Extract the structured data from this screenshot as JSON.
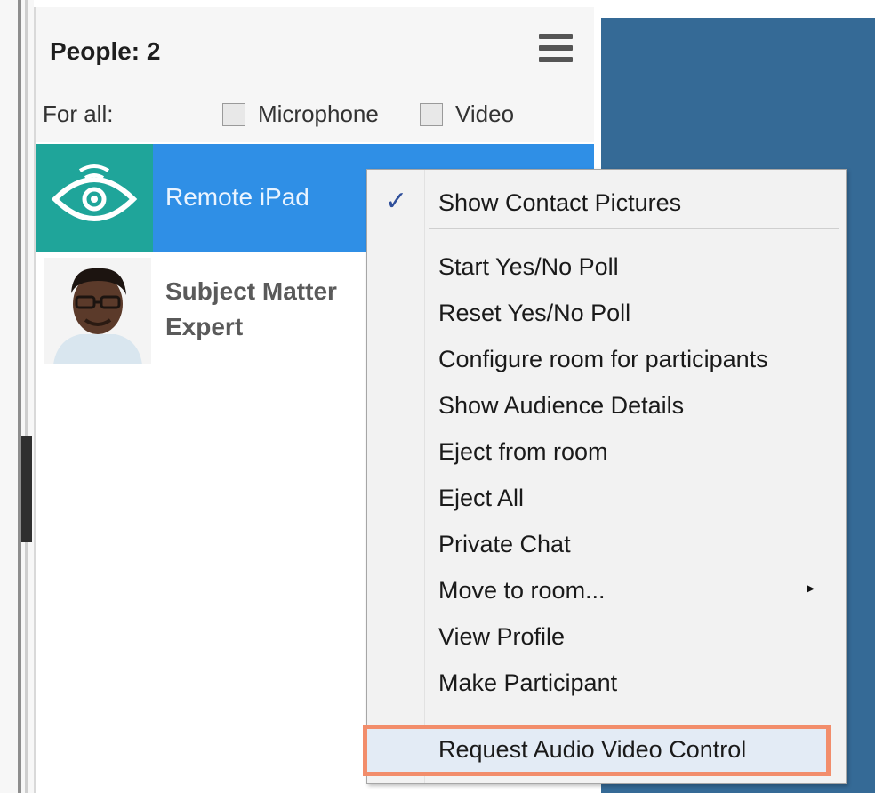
{
  "people_panel": {
    "header": "People: 2",
    "for_all_label": "For all:",
    "microphone_label": "Microphone",
    "video_label": "Video",
    "participants": [
      {
        "name": "Remote iPad"
      },
      {
        "name_line1": "Subject Matter",
        "name_line2": "Expert"
      }
    ]
  },
  "context_menu": {
    "items": [
      {
        "label": "Show Contact Pictures",
        "checked": true
      },
      {
        "label": "Start Yes/No Poll"
      },
      {
        "label": "Reset Yes/No Poll"
      },
      {
        "label": "Configure room for participants"
      },
      {
        "label": "Show Audience Details"
      },
      {
        "label": "Eject from room"
      },
      {
        "label": "Eject All"
      },
      {
        "label": "Private Chat"
      },
      {
        "label": "Move to room...",
        "submenu_arrow": "▸"
      },
      {
        "label": "View Profile"
      },
      {
        "label": "Make Participant"
      },
      {
        "label": "Request Audio Video Control",
        "highlighted": true
      }
    ],
    "check_glyph": "✓"
  },
  "colors": {
    "selected_row": "#2f8fe6",
    "eye_tile": "#1fa59a",
    "right_area": "#356a96",
    "highlight_border": "#f28d6b"
  },
  "icons": {
    "menu": "hamburger-icon",
    "eye": "eye-broadcast-icon",
    "check": "check-icon",
    "arrow": "submenu-arrow-icon"
  }
}
